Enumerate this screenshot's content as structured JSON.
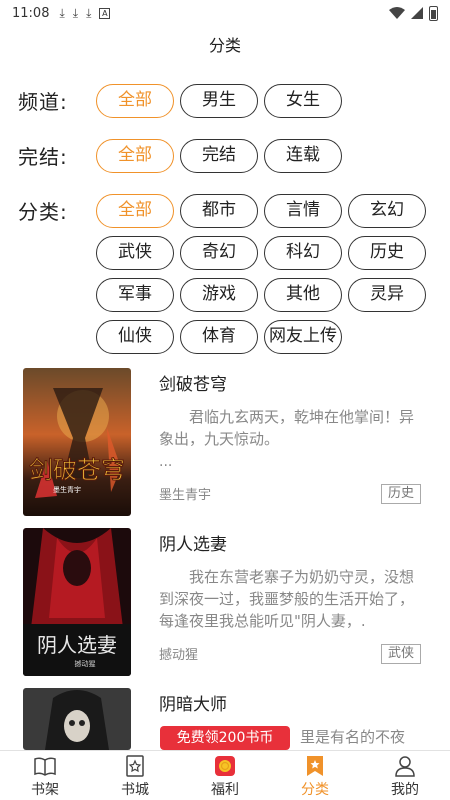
{
  "status_bar": {
    "time": "11:08",
    "notifications": [
      "download",
      "download",
      "download",
      "A"
    ]
  },
  "page": {
    "title": "分类"
  },
  "filters": {
    "channel": {
      "label": "频道:",
      "options": [
        "全部",
        "男生",
        "女生"
      ],
      "selected": "全部"
    },
    "status": {
      "label": "完结:",
      "options": [
        "全部",
        "完结",
        "连载"
      ],
      "selected": "全部"
    },
    "category": {
      "label": "分类:",
      "options": [
        "全部",
        "都市",
        "言情",
        "玄幻",
        "武侠",
        "奇幻",
        "科幻",
        "历史",
        "军事",
        "游戏",
        "其他",
        "灵异",
        "仙侠",
        "体育",
        "网友上传"
      ],
      "selected": "全部"
    }
  },
  "books": [
    {
      "title": "剑破苍穹",
      "description": "君临九玄两天，乾坤在他掌间！异象出，九天惊动。",
      "more": "...",
      "author": "墨生青宇",
      "tag": "历史",
      "cover_text": "剑破苍穹",
      "cover_sub": "墨生青宇"
    },
    {
      "title": "阴人选妻",
      "description": "我在东营老寨子为奶奶守灵，没想到深夜一过，我噩梦般的生活开始了，每逢夜里我总能听见\"阴人妻，.",
      "author": "撼动猩",
      "tag": "武侠",
      "cover_text": "阴人选妻",
      "cover_sub": "撼动猩"
    },
    {
      "title": "阴暗大师",
      "description": "里是有名的不夜"
    }
  ],
  "promo": {
    "label": "免费领200书币"
  },
  "tabs": [
    {
      "label": "书架",
      "icon": "bookshelf-icon"
    },
    {
      "label": "书城",
      "icon": "bookstore-icon"
    },
    {
      "label": "福利",
      "icon": "gift-coin-icon"
    },
    {
      "label": "分类",
      "icon": "category-icon",
      "active": true
    },
    {
      "label": "我的",
      "icon": "profile-icon"
    }
  ],
  "colors": {
    "accent": "#f0922a",
    "promo": "#e8303a",
    "text_secondary": "#888888"
  }
}
